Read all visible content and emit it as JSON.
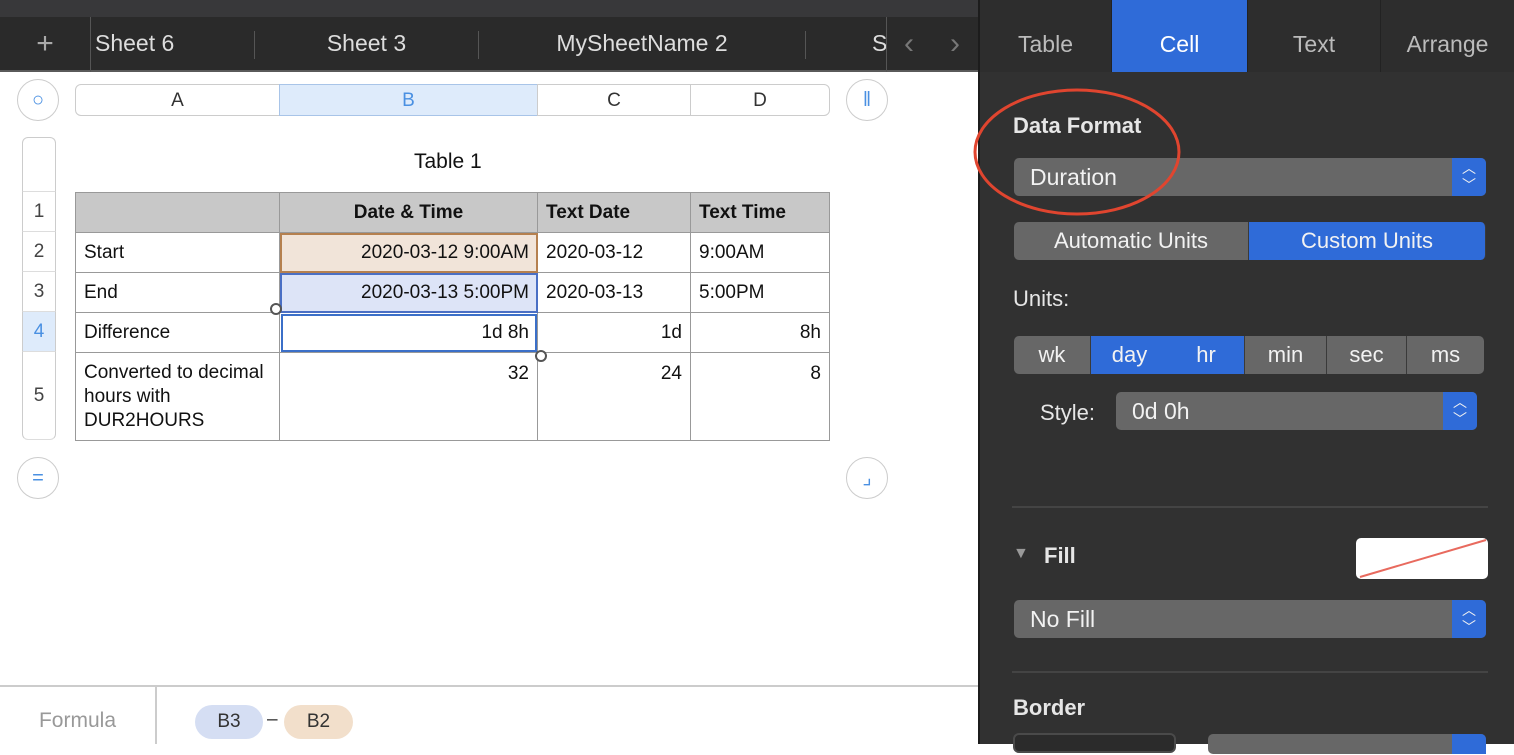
{
  "sheet_tabs": [
    "Sheet 6",
    "Sheet 3",
    "MySheetName 2",
    "S"
  ],
  "icons": {
    "add": "plus-icon",
    "prev": "chevron-left-icon",
    "next": "chevron-right-icon"
  },
  "columns": [
    "A",
    "B",
    "C",
    "D"
  ],
  "table": {
    "title": "Table 1",
    "row_numbers": [
      "1",
      "2",
      "3",
      "4",
      "5"
    ],
    "rows": [
      [
        "",
        "Date & Time",
        "Text Date",
        "Text Time"
      ],
      [
        "Start",
        "2020-03-12 9:00AM",
        "2020-03-12",
        "9:00AM"
      ],
      [
        "End",
        "2020-03-13 5:00PM",
        "2020-03-13",
        "5:00PM"
      ],
      [
        "Difference",
        "1d 8h",
        "1d",
        "8h"
      ],
      [
        "Converted to decimal hours with DUR2HOURS",
        "32",
        "24",
        "8"
      ]
    ]
  },
  "formula": {
    "label": "Formula",
    "token1": "B3",
    "operator": "–",
    "token2": "B2"
  },
  "panel": {
    "tabs": [
      "Table",
      "Cell",
      "Text",
      "Arrange"
    ],
    "active_tab": "Cell",
    "data_format_label": "Data Format",
    "data_format_value": "Duration",
    "unit_modes": [
      "Automatic Units",
      "Custom Units"
    ],
    "units_label": "Units:",
    "units": [
      "wk",
      "day",
      "hr",
      "min",
      "sec",
      "ms"
    ],
    "selected_units": [
      "day",
      "hr"
    ],
    "style_label": "Style:",
    "style_value": "0d 0h",
    "fill_label": "Fill",
    "fill_value": "No Fill",
    "border_label": "Border"
  },
  "colors": {
    "accent": "#2f6bd8",
    "annotation": "#e0452f"
  }
}
